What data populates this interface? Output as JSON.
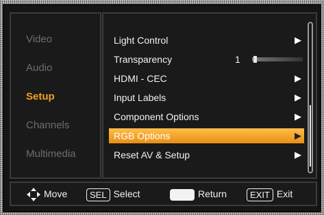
{
  "left_menu": {
    "items": [
      {
        "label": "Video",
        "active": false
      },
      {
        "label": "Audio",
        "active": false
      },
      {
        "label": "Setup",
        "active": true
      },
      {
        "label": "Channels",
        "active": false
      },
      {
        "label": "Multimedia",
        "active": false
      }
    ]
  },
  "setup_menu": {
    "items": [
      {
        "label": "Light Control",
        "arrow": "▶"
      },
      {
        "label": "Transparency",
        "value": "1",
        "slider_fraction": 0.03
      },
      {
        "label": "HDMI - CEC",
        "arrow": "▶"
      },
      {
        "label": "Input Labels",
        "arrow": "▶"
      },
      {
        "label": "Component Options",
        "arrow": "▶"
      },
      {
        "label": "RGB Options",
        "arrow": "▶",
        "selected": true
      },
      {
        "label": "Reset AV & Setup",
        "arrow": "▶"
      }
    ],
    "scroll_position_fraction": 0.56,
    "scroll_visible_fraction": 0.42
  },
  "footer": {
    "move": "Move",
    "sel_key": "SEL",
    "select": "Select",
    "return": "Return",
    "exit_key": "EXIT",
    "exit": "Exit"
  },
  "colors": {
    "accent": "#f0a21f",
    "selection_top": "#ffbe4b",
    "selection_bottom": "#e98f14",
    "background": "#151515",
    "inactive_text": "#6e6e6e"
  }
}
